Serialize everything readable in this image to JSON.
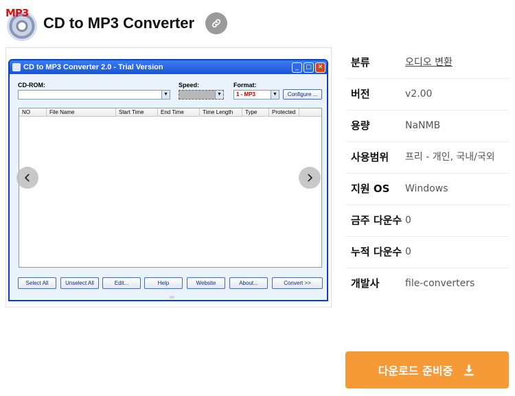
{
  "header": {
    "logo_text": "MP3",
    "title": "CD to MP3 Converter",
    "link_icon": "link-icon"
  },
  "screenshot": {
    "window_title": "CD to MP3 Converter 2.0 - Trial Version",
    "cdrom_label": "CD-ROM:",
    "speed_label": "Speed:",
    "format_label": "Format:",
    "format_value": "1 - MP3",
    "configure_label": "Configure ...",
    "columns": [
      "NO",
      "File Name",
      "Start Time",
      "End Time",
      "Time Length",
      "Type",
      "Protected"
    ],
    "buttons": [
      "Select All",
      "Unselect All",
      "Edit...",
      "Help",
      "Website",
      "About...",
      "Convert >>"
    ]
  },
  "info": {
    "rows": [
      {
        "key": "분류",
        "value": "오디오 변환"
      },
      {
        "key": "버전",
        "value": "v2.00"
      },
      {
        "key": "용량",
        "value": "NaNMB"
      },
      {
        "key": "사용범위",
        "value": "프리 - 개인, 국내/국외"
      },
      {
        "key": "지원 OS",
        "value": "Windows"
      },
      {
        "key": "금주 다운수",
        "value": "0"
      },
      {
        "key": "누적 다운수",
        "value": "0"
      },
      {
        "key": "개발사",
        "value": "file-converters"
      }
    ]
  },
  "download": {
    "label": "다운로드 준비중"
  },
  "colors": {
    "download_bg": "#f59a36",
    "titlebar": "#1654d8"
  }
}
